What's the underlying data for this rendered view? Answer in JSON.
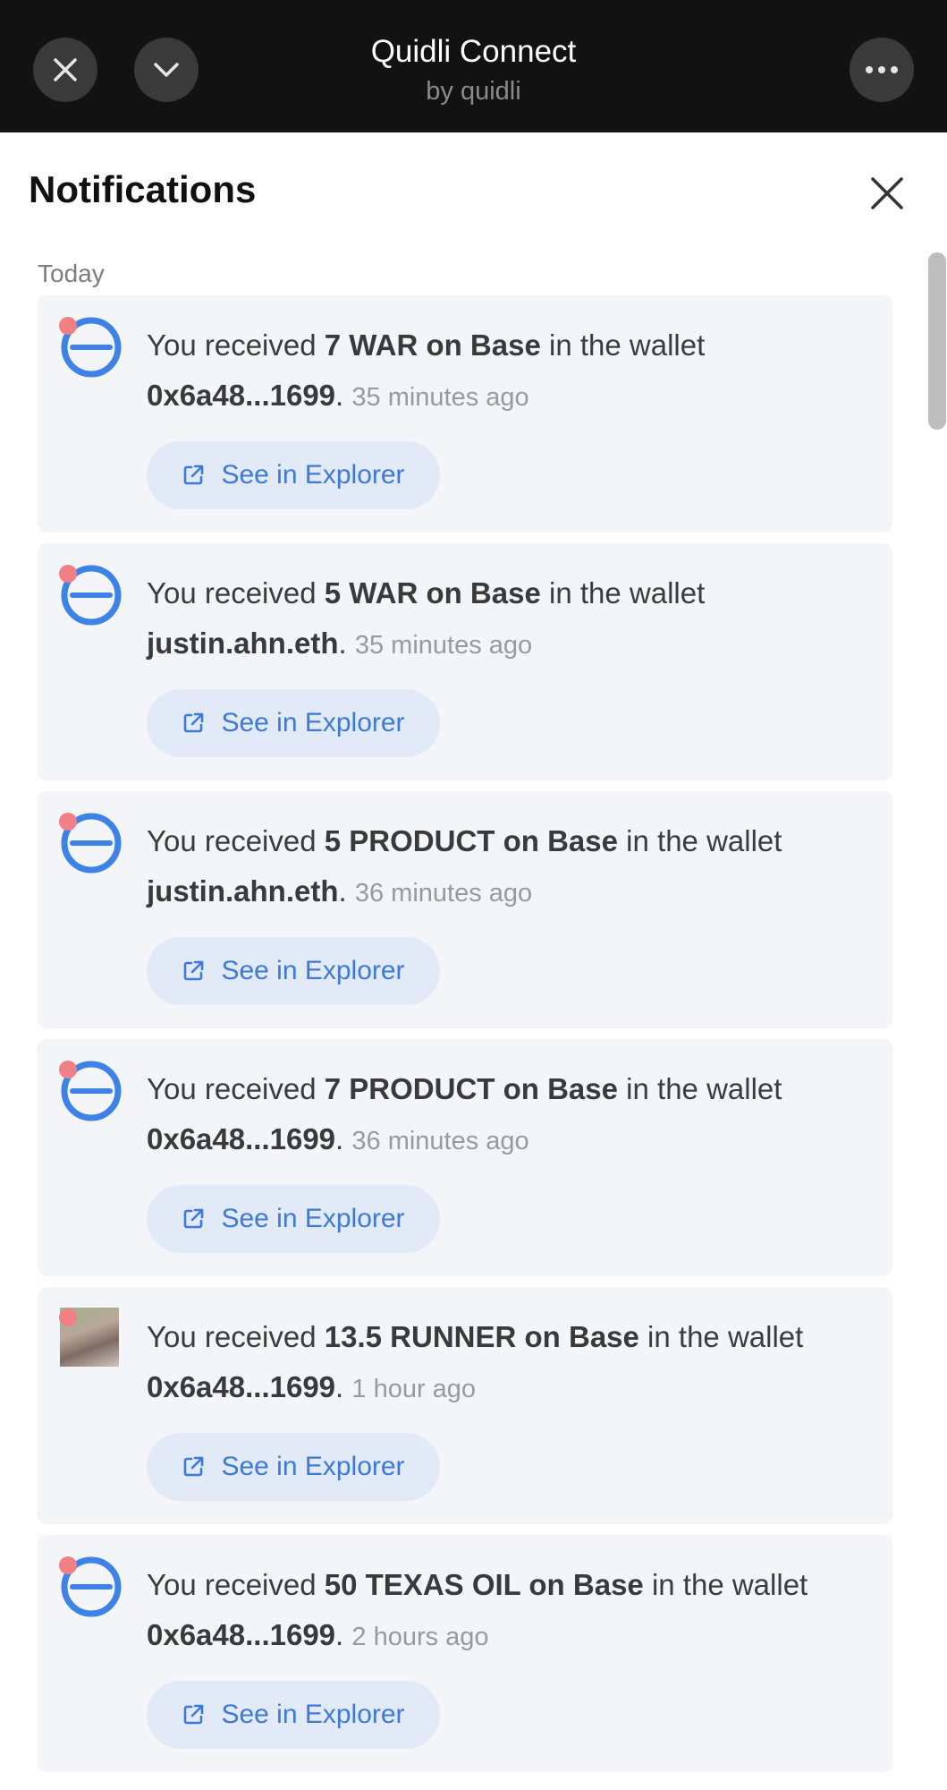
{
  "app": {
    "title": "Quidli Connect",
    "subtitle": "by quidli"
  },
  "panel": {
    "title": "Notifications",
    "section": "Today"
  },
  "colors": {
    "accent": "#3c79d8",
    "unread": "#f07f86",
    "token_icon": "#3d82e6"
  },
  "notifications": [
    {
      "icon": "token-minus-icon",
      "prefix": "You received ",
      "amount": "7 WAR on Base",
      "middle": " in the wallet ",
      "wallet": "0x6a48...1699",
      "suffix": ". ",
      "time": "35 minutes ago",
      "button": "See in Explorer"
    },
    {
      "icon": "token-minus-icon",
      "prefix": "You received ",
      "amount": "5 WAR on Base",
      "middle": " in the wallet ",
      "wallet": "justin.ahn.eth",
      "suffix": ". ",
      "time": "35 minutes ago",
      "button": "See in Explorer"
    },
    {
      "icon": "token-minus-icon",
      "prefix": "You received ",
      "amount": "5 PRODUCT on Base",
      "middle": " in the wallet ",
      "wallet": "justin.ahn.eth",
      "suffix": ". ",
      "time": "36 minutes ago",
      "button": "See in Explorer"
    },
    {
      "icon": "token-minus-icon",
      "prefix": "You received ",
      "amount": "7 PRODUCT on Base",
      "middle": " in the wallet ",
      "wallet": "0x6a48...1699",
      "suffix": ". ",
      "time": "36 minutes ago",
      "button": "See in Explorer"
    },
    {
      "icon": "runner-avatar-icon",
      "prefix": "You received ",
      "amount": "13.5 RUNNER on Base",
      "middle": " in the wallet ",
      "wallet": "0x6a48...1699",
      "suffix": ". ",
      "time": "1 hour ago",
      "button": "See in Explorer"
    },
    {
      "icon": "token-minus-icon",
      "prefix": "You received ",
      "amount": "50 TEXAS OIL on Base",
      "middle": " in the wallet ",
      "wallet": "0x6a48...1699",
      "suffix": ". ",
      "time": "2 hours ago",
      "button": "See in Explorer"
    }
  ]
}
